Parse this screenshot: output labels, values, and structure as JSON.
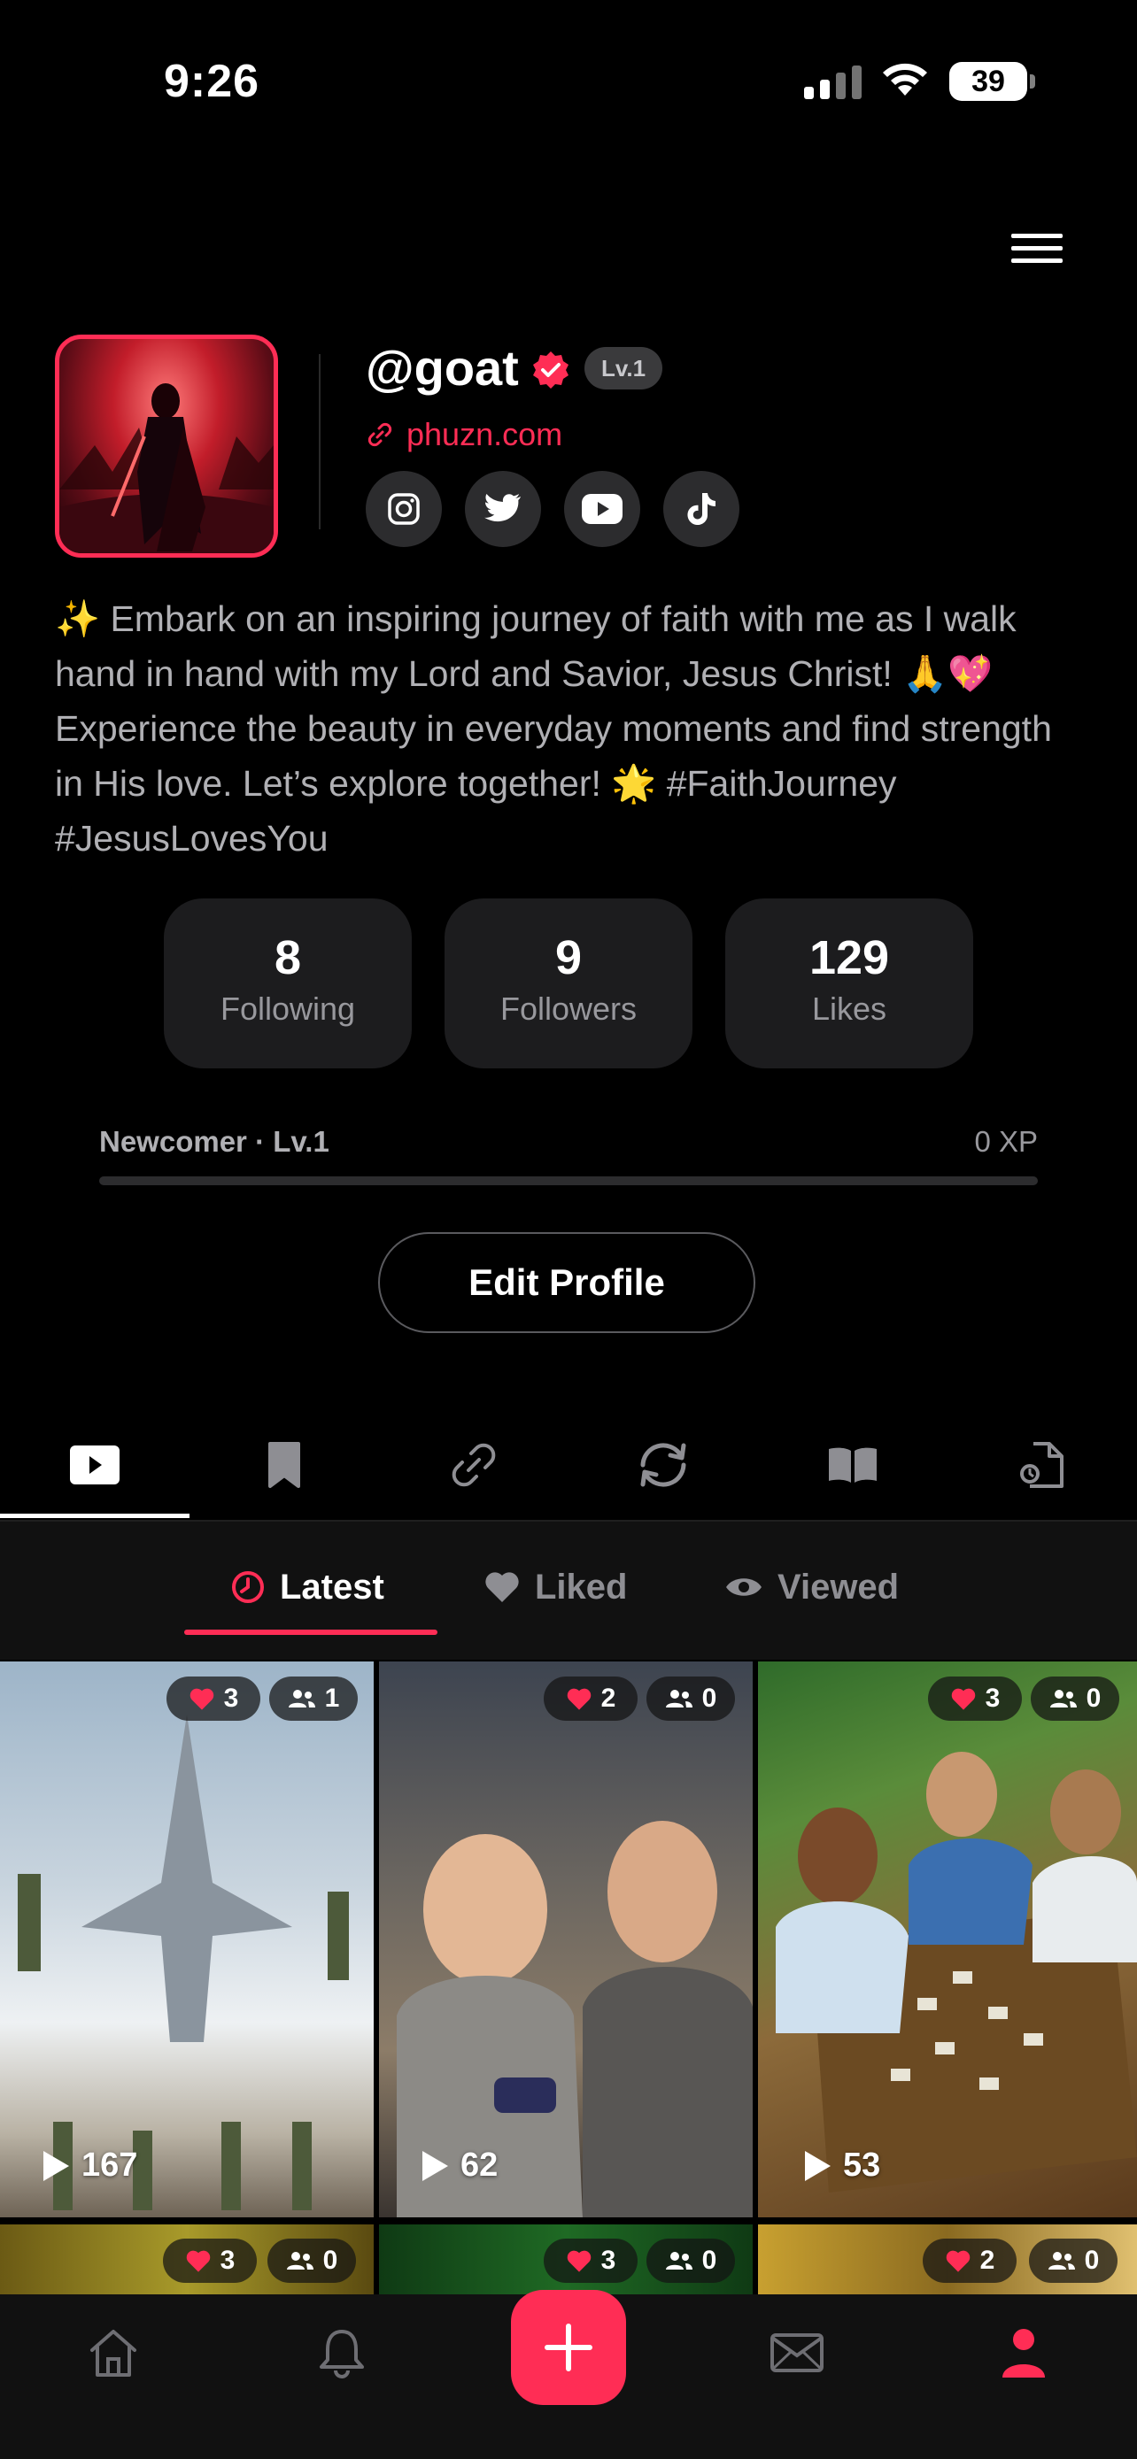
{
  "status_bar": {
    "time": "9:26",
    "battery": "39"
  },
  "profile": {
    "username": "@goat",
    "level_badge": "Lv.1",
    "link": "phuzn.com",
    "bio": "✨ Embark on an inspiring journey of faith with me as I walk hand in hand with my Lord and Savior, Jesus Christ! 🙏💖 Experience the beauty in everyday moments and find strength in His love. Let’s explore together! 🌟 #FaithJourney #JesusLovesYou",
    "socials": [
      "instagram-icon",
      "twitter-icon",
      "youtube-icon",
      "tiktok-icon"
    ]
  },
  "stats": [
    {
      "value": "8",
      "label": "Following"
    },
    {
      "value": "9",
      "label": "Followers"
    },
    {
      "value": "129",
      "label": "Likes"
    }
  ],
  "level": {
    "label": "Newcomer · Lv.1",
    "xp": "0 XP",
    "progress": 0
  },
  "edit_profile_label": "Edit Profile",
  "content_tabs": [
    "videos-tab-icon",
    "bookmark-icon",
    "link-icon",
    "repost-icon",
    "book-icon",
    "document-icon"
  ],
  "sub_tabs": {
    "latest": "Latest",
    "liked": "Liked",
    "viewed": "Viewed"
  },
  "videos": [
    {
      "likes": "3",
      "collabs": "1",
      "views": "167"
    },
    {
      "likes": "2",
      "collabs": "0",
      "views": "62"
    },
    {
      "likes": "3",
      "collabs": "0",
      "views": "53"
    },
    {
      "likes": "3",
      "collabs": "0"
    },
    {
      "likes": "3",
      "collabs": "0"
    },
    {
      "likes": "2",
      "collabs": "0"
    }
  ],
  "colors": {
    "accent": "#ff2d55",
    "background": "#000000",
    "card": "#1c1c1e"
  }
}
